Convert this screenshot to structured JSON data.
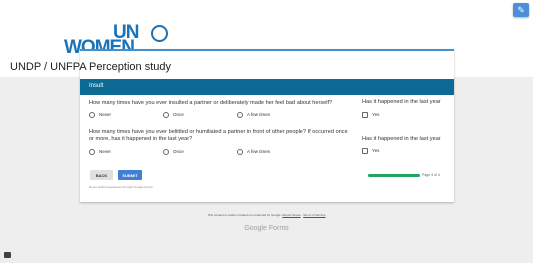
{
  "logo": {
    "text_un": "UN",
    "text_women": "WOMEN",
    "color": "#1a73b8"
  },
  "edit_button": {
    "icon": "pencil-icon",
    "glyph": "✎"
  },
  "form": {
    "title": "UNDP / UNFPA Perception study",
    "accent_color": "#3f91cf",
    "section": {
      "title": "Insult",
      "color": "#0c6a94"
    },
    "questions": [
      {
        "text": "How many times have you ever insulted a partner or deliberately made her feel bad about herself?",
        "options": [
          "Never",
          "Once",
          "A few times"
        ],
        "followup": {
          "text": "Has it happened in the last year",
          "option": "Yes"
        }
      },
      {
        "text": "How many times have you ever belittled or humiliated a partner in front of other people? If occurred once or more, has it happened in the last year?",
        "options": [
          "Never",
          "Once",
          "A few times"
        ],
        "followup": {
          "text": "Has it happened in the last year",
          "option": "Yes"
        }
      }
    ],
    "buttons": {
      "back": "BACK",
      "submit": "SUBMIT"
    },
    "progress": {
      "text": "Page 4 of 4",
      "fraction": 1.0,
      "color": "#1fa463"
    },
    "never_submit": "Never submit passwords through Google Forms."
  },
  "footer": {
    "disclaimer_prefix": "This content is neither created nor endorsed by Google.",
    "report_abuse": "Report Abuse",
    "separator": "-",
    "terms": "Terms of Service",
    "brand": "Google Forms"
  }
}
